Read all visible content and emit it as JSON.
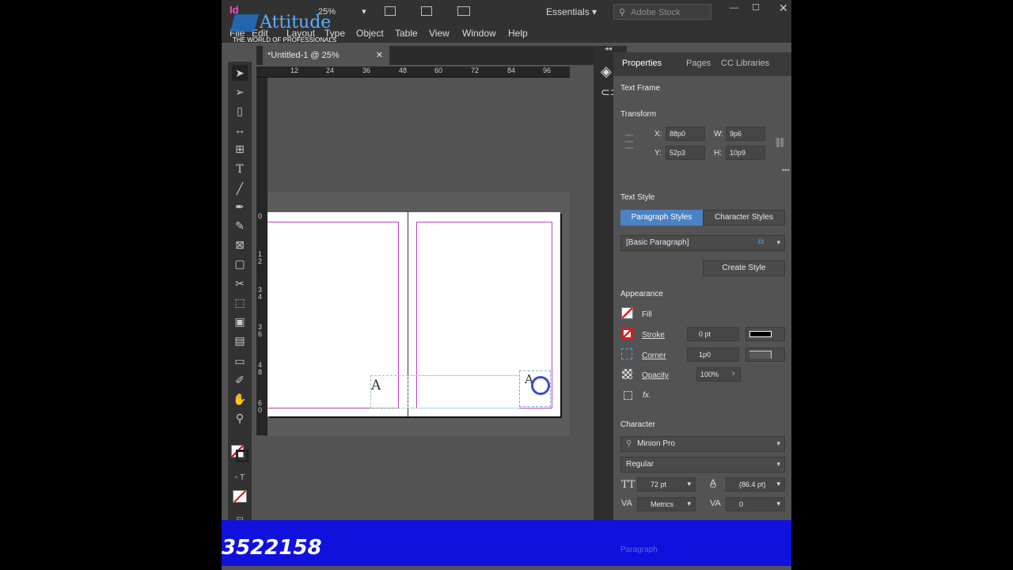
{
  "topbar": {
    "zoom": "25%",
    "workspace": "Essentials",
    "search_placeholder": "Adobe Stock",
    "logo_text": "Attitude",
    "logo_tagline": "THE WORLD OF PROFESSIONALS"
  },
  "menu": {
    "items": [
      "File",
      "Edit",
      "Layout",
      "Type",
      "Object",
      "Table",
      "View",
      "Window",
      "Help"
    ]
  },
  "document": {
    "tab_title": "*Untitled-1 @ 25%",
    "close": "✕"
  },
  "ruler": {
    "h_ticks": [
      "12",
      "24",
      "36",
      "48",
      "60",
      "72",
      "84",
      "96"
    ],
    "v_ticks": [
      "0",
      "1",
      "2",
      "3",
      "4",
      "3",
      "6",
      "4",
      "8",
      "6",
      "0"
    ]
  },
  "panel": {
    "tabs": [
      "Properties",
      "Pages",
      "CC Libraries"
    ],
    "object_type": "Text Frame",
    "transform": {
      "title": "Transform",
      "x_label": "X:",
      "x": "88p0",
      "y_label": "Y:",
      "y": "52p3",
      "w_label": "W:",
      "w": "9p6",
      "h_label": "H:",
      "h": "10p9"
    },
    "text_style": {
      "title": "Text Style",
      "paragraph_tab": "Paragraph Styles",
      "character_tab": "Character Styles",
      "selected_style": "[Basic Paragraph]",
      "create_button": "Create Style"
    },
    "appearance": {
      "title": "Appearance",
      "fill": "Fill",
      "stroke": "Stroke",
      "stroke_value": "0 pt",
      "corner": "Corner",
      "corner_value": "1p0",
      "opacity": "Opacity",
      "opacity_value": "100%",
      "fx": "fx."
    },
    "character": {
      "title": "Character",
      "font": "Minion Pro",
      "style": "Regular",
      "size": "72 pt",
      "leading": "(86.4 pt)",
      "kerning": "Metrics",
      "tracking": "0"
    },
    "paragraph": "Paragraph"
  },
  "canvas": {
    "glyph": "A"
  },
  "banner": {
    "number": "3522158"
  },
  "colors": {
    "accent": "#4a82c4",
    "banner": "#1111dd",
    "margin_guide": "#c43fc4"
  }
}
